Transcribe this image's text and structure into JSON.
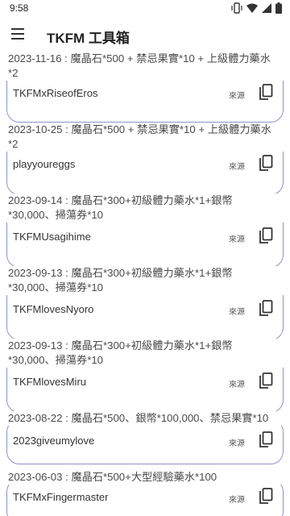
{
  "status_bar": {
    "time": "9:58"
  },
  "app_bar": {
    "title": "TKFM 工具箱"
  },
  "items": [
    {
      "date_reward": "2023-11-16 : 魔晶石*500 + 禁忌果實*10 + 上級體力藥水\n*2",
      "code": "TKFMxRiseofEros",
      "source_label": "來源"
    },
    {
      "date_reward": "2023-10-25 : 魔晶石*500 + 禁忌果實*10 + 上級體力藥水\n*2",
      "code": "playyoureggs",
      "source_label": "來源"
    },
    {
      "date_reward": "2023-09-14 : 魔晶石*300+初級體力藥水*1+銀幣\n*30,000、掃蕩券*10",
      "code": "TKFMUsagihime",
      "source_label": "來源"
    },
    {
      "date_reward": "2023-09-13 : 魔晶石*300+初級體力藥水*1+銀幣\n*30,000、掃蕩券*10",
      "code": "TKFMlovesNyoro",
      "source_label": "來源"
    },
    {
      "date_reward": "2023-09-13 : 魔晶石*300+初級體力藥水*1+銀幣\n*30,000、掃蕩券*10",
      "code": "TKFMlovesMiru",
      "source_label": "來源"
    },
    {
      "date_reward": "2023-08-22 : 魔晶石*500、銀幣*100,000、禁忌果實*10",
      "code": "2023giveumylove",
      "source_label": "來源"
    },
    {
      "date_reward": "2023-06-03 : 魔晶石*500+大型經驗藥水*100",
      "code": "TKFMxFingermaster",
      "source_label": "來源"
    }
  ]
}
